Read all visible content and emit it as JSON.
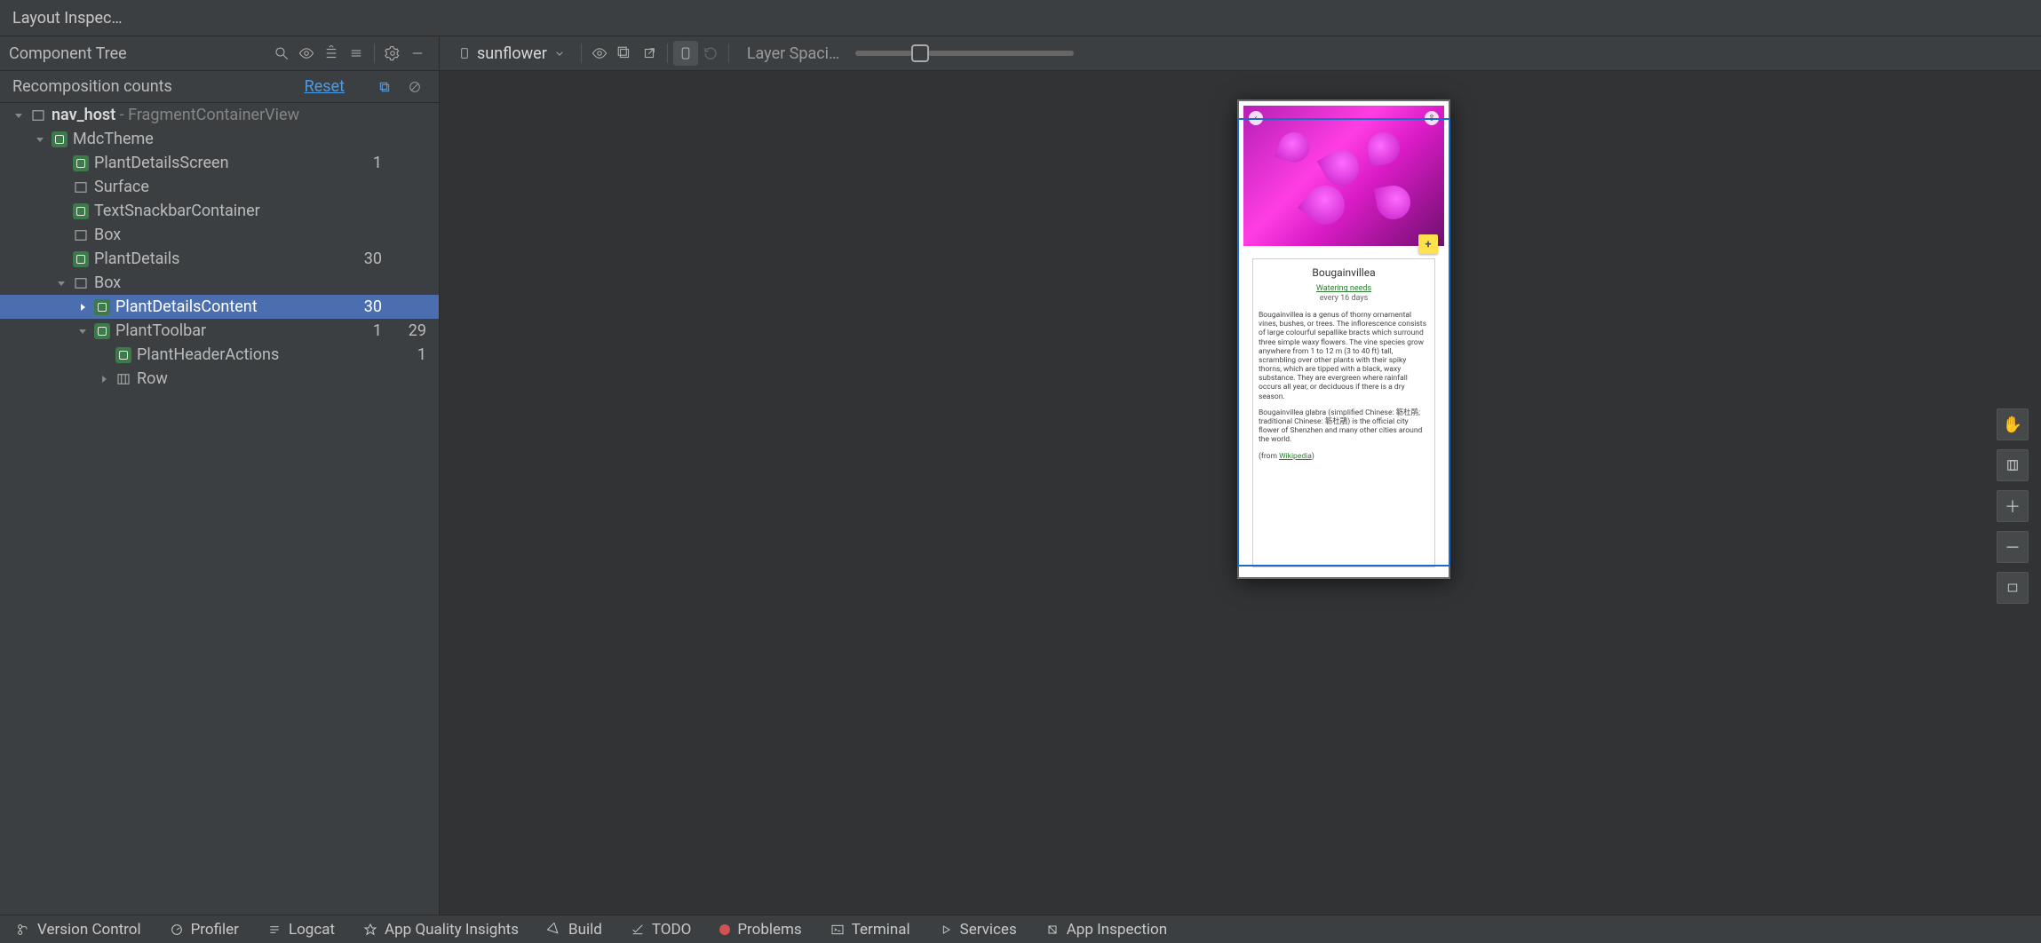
{
  "window": {
    "title": "Layout Inspec…"
  },
  "left": {
    "header": "Component Tree",
    "recomposition_label": "Recomposition counts",
    "reset": "Reset"
  },
  "tree": [
    {
      "depth": 0,
      "chev": "down",
      "icon": "view",
      "bold": true,
      "label": "nav_host",
      "suffix": " - FragmentContainerView"
    },
    {
      "depth": 1,
      "chev": "down",
      "icon": "compose",
      "label": "MdcTheme"
    },
    {
      "depth": 2,
      "chev": "",
      "icon": "compose",
      "label": "PlantDetailsScreen",
      "c1": "1"
    },
    {
      "depth": 2,
      "chev": "",
      "icon": "view",
      "label": "Surface"
    },
    {
      "depth": 2,
      "chev": "",
      "icon": "compose",
      "label": "TextSnackbarContainer"
    },
    {
      "depth": 2,
      "chev": "",
      "icon": "view",
      "label": "Box"
    },
    {
      "depth": 2,
      "chev": "",
      "icon": "compose",
      "label": "PlantDetails",
      "c1": "30"
    },
    {
      "depth": 2,
      "chev": "down",
      "icon": "view",
      "label": "Box"
    },
    {
      "depth": 3,
      "chev": "right",
      "icon": "compose",
      "label": "PlantDetailsContent",
      "c1": "30",
      "selected": true,
      "treeline": true
    },
    {
      "depth": 3,
      "chev": "down",
      "icon": "compose",
      "label": "PlantToolbar",
      "c1": "1",
      "c2": "29",
      "treeline": true
    },
    {
      "depth": 4,
      "chev": "",
      "icon": "compose",
      "label": "PlantHeaderActions",
      "c2": "1"
    },
    {
      "depth": 4,
      "chev": "right",
      "icon": "col",
      "label": "Row"
    }
  ],
  "right": {
    "process": "sunflower",
    "layer_label": "Layer Spaci…",
    "selection": {
      "name": "PlantDetailsContent",
      "count": "30"
    }
  },
  "preview": {
    "title": "Bougainvillea",
    "watering_heading": "Watering needs",
    "watering_detail": "every 16 days",
    "para1": "Bougainvillea is a genus of thorny ornamental vines, bushes, or trees. The inflorescence consists of large colourful sepallike bracts which surround three simple waxy flowers. The vine species grow anywhere from 1 to 12 m (3 to 40 ft) tall, scrambling over other plants with their spiky thorns, which are tipped with a black, waxy substance. They are evergreen where rainfall occurs all year, or deciduous if there is a dry season.",
    "para2_prefix": "Bougainvillea glabra (simplified Chinese: 簕杜鹃; traditional Chinese: 簕杜鵑) is the official city flower of Shenzhen and many other cities around the world.",
    "source_prefix": "(from ",
    "source_link": "Wikipedia",
    "source_suffix": ")"
  },
  "status": {
    "version_control": "Version Control",
    "profiler": "Profiler",
    "logcat": "Logcat",
    "app_quality": "App Quality Insights",
    "build": "Build",
    "todo": "TODO",
    "problems": "Problems",
    "terminal": "Terminal",
    "services": "Services",
    "app_inspection": "App Inspection"
  }
}
